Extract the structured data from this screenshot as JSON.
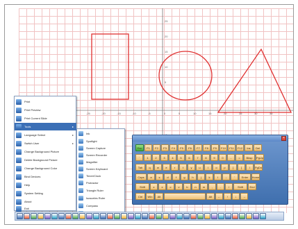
{
  "canvas": {
    "axis_y_labels": [
      "25",
      "20",
      "15",
      "10",
      "5",
      "-5"
    ],
    "axis_x_labels": [
      "-25",
      "-20",
      "-15",
      "-10",
      "-5",
      "0",
      "5",
      "10",
      "15",
      "20",
      "25",
      "30",
      "35"
    ],
    "shape_color": "#e03030",
    "grid_color": "#f1c3c3"
  },
  "menu": {
    "items": [
      {
        "label": "Print",
        "icon": "printer-icon"
      },
      {
        "label": "Print Preview",
        "icon": "print-preview-icon"
      },
      {
        "label": "Print Current Slide",
        "icon": "print-slide-icon"
      },
      {
        "label": "Tools",
        "icon": "tools-icon",
        "has_submenu": true,
        "active": true
      },
      {
        "label": "Language Select",
        "icon": "language-icon",
        "has_submenu": true
      },
      {
        "label": "Switch User",
        "icon": "switch-user-icon",
        "has_submenu": true
      },
      {
        "label": "Change Background Picture",
        "icon": "background-picture-icon"
      },
      {
        "label": "Delete Background Picture",
        "icon": "delete-background-icon"
      },
      {
        "label": "Change Background Color",
        "icon": "background-color-icon"
      },
      {
        "label": "Bind Devices",
        "icon": "bind-devices-icon"
      },
      {
        "label": "Help",
        "icon": "help-icon"
      },
      {
        "label": "System Setting",
        "icon": "settings-icon"
      },
      {
        "label": "About",
        "icon": "about-icon"
      },
      {
        "label": "Exit",
        "icon": "exit-icon"
      }
    ]
  },
  "submenu": {
    "items": [
      {
        "label": "Ink",
        "icon": "ink-icon"
      },
      {
        "label": "Spotlight",
        "icon": "spotlight-icon"
      },
      {
        "label": "Screen Capture",
        "icon": "screen-capture-icon"
      },
      {
        "label": "Screen Recorder",
        "icon": "screen-recorder-icon"
      },
      {
        "label": "Magnifier",
        "icon": "magnifier-icon"
      },
      {
        "label": "Screen Keyboard",
        "icon": "keyboard-icon"
      },
      {
        "label": "Timer/Clock",
        "icon": "clock-icon"
      },
      {
        "label": "Protractor",
        "icon": "protractor-icon"
      },
      {
        "label": "Triangle Ruler",
        "icon": "triangle-ruler-icon"
      },
      {
        "label": "Isosceles Ruler",
        "icon": "isosceles-ruler-icon"
      },
      {
        "label": "Compass",
        "icon": "compass-icon"
      },
      {
        "label": "Ruler",
        "icon": "ruler-icon"
      }
    ]
  },
  "keyboard": {
    "key_color": "#f0c275",
    "frame_color": "#4f7dbb",
    "rows": [
      [
        "Esc",
        "F1",
        "F2",
        "F3",
        "F4",
        "F5",
        "F6",
        "F7",
        "F8",
        "F9",
        "F10",
        "F11",
        "F12",
        "Ins",
        "Del"
      ],
      [
        "`",
        "1",
        "2",
        "3",
        "4",
        "5",
        "6",
        "7",
        "8",
        "9",
        "0",
        "-",
        "=",
        "Bksp",
        "PgUp"
      ],
      [
        "Tab",
        "q",
        "w",
        "e",
        "r",
        "t",
        "y",
        "u",
        "i",
        "o",
        "p",
        "[",
        "]",
        "\\",
        "PgDn"
      ],
      [
        "Caps",
        "a",
        "s",
        "d",
        "f",
        "g",
        "h",
        "j",
        "k",
        "l",
        ";",
        "'",
        "Enter",
        "Home"
      ],
      [
        "Shift",
        "z",
        "x",
        "c",
        "v",
        "b",
        "n",
        "m",
        ",",
        ".",
        "/",
        "Shift",
        "End"
      ],
      [
        "Ctrl",
        "Win",
        "Alt",
        "",
        "Alt",
        "←",
        "↑",
        "↓",
        "→"
      ]
    ]
  },
  "taskbar": {
    "button_count": 36,
    "button_colors": [
      "#3b6fb6",
      "#e85d3a",
      "#4fa84a",
      "#f2b233",
      "#7c5cc4",
      "#2aa4c8"
    ]
  }
}
